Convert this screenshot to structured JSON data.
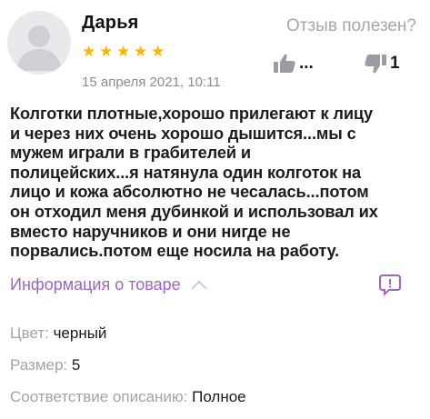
{
  "review": {
    "author": "Дарья",
    "rating": 5,
    "date": "15 апреля 2021, 10:11",
    "helpful_question": "Отзыв полезен?",
    "likes": "...",
    "dislikes": "1",
    "text": "Колготки плотные,хорошо прилегают к лицу\nи через них очень хорошо дышится...мы с\nмужем играли в грабителей  и\nполицейских...я натянула один колготок на\nлицо и кожа абсолютно не чесалась...потом\nон отходил меня дубинкой и использовал их\nвместо наручников и они нигде не\nпорвались.потом еще носила на работу.",
    "product_info_label": "Информация о товаре",
    "attributes": {
      "color_label": "Цвет:",
      "color_value": "черный",
      "size_label": "Размер:",
      "size_value": "5",
      "match_label": "Соответствие описанию:",
      "match_value": "Полное"
    }
  },
  "colors": {
    "stars": "#ffb400",
    "link": "#a063c9",
    "muted": "#a6a6ae"
  },
  "icons": {
    "avatar": "user-placeholder-icon",
    "like": "thumbs-up-icon",
    "dislike": "thumbs-down-icon",
    "comment": "comment-icon",
    "chevron": "chevron-up-icon"
  }
}
